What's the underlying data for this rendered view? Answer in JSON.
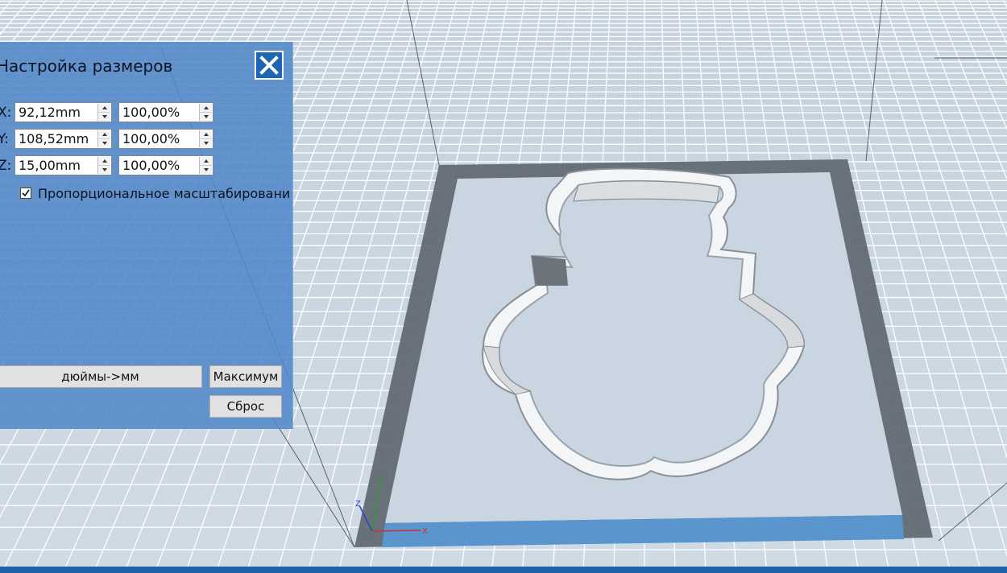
{
  "dialog": {
    "title": "Настройка размеров",
    "close_icon": "close-x-icon"
  },
  "dimensions": [
    {
      "axis": "X:",
      "size": "92,12mm",
      "percent": "100,00%"
    },
    {
      "axis": "Y:",
      "size": "108,52mm",
      "percent": "100,00%"
    },
    {
      "axis": "Z:",
      "size": "15,00mm",
      "percent": "100,00%"
    }
  ],
  "proportional": {
    "label": "Пропорциональное масштабировани",
    "checked": true
  },
  "buttons": {
    "inches_to_mm": "дюймы->мм",
    "maximum": "Максимум",
    "reset": "Сброс"
  },
  "axes_gizmo": {
    "x": "X",
    "y": "Y",
    "z": "Z"
  },
  "colors": {
    "panel": "#5288c8",
    "accent": "#1b66b5",
    "build_plate_frame": "#67707a",
    "model": "#e8e9ea"
  }
}
